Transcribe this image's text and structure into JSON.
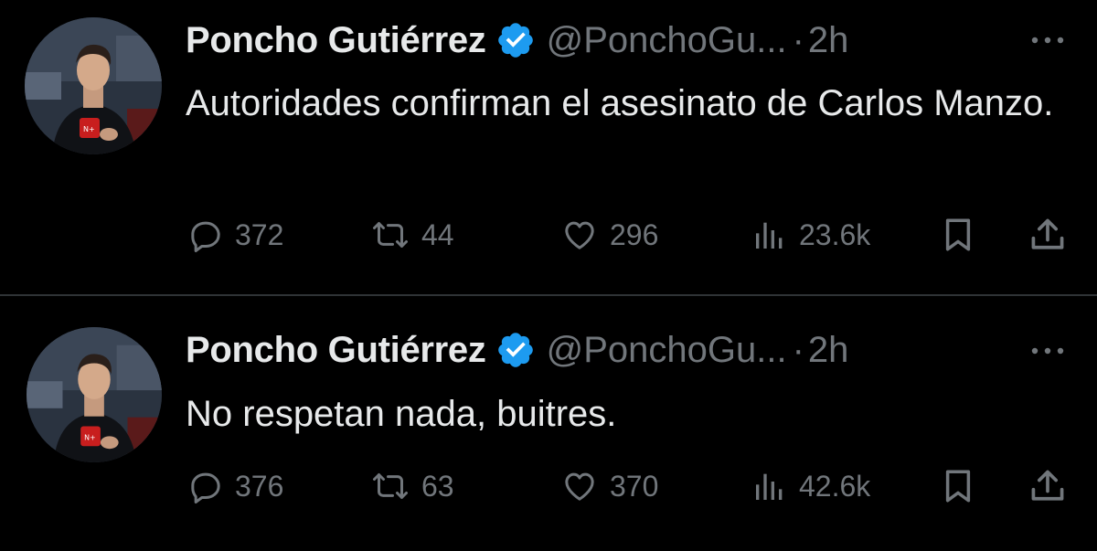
{
  "tweets": [
    {
      "author": {
        "name": "Poncho Gutiérrez",
        "handle": "@PonchoGu...",
        "verified": true
      },
      "time": "2h",
      "separator": "·",
      "text": "Autoridades confirman el asesinato de Carlos Manzo.",
      "stats": {
        "replies": "372",
        "retweets": "44",
        "likes": "296",
        "views": "23.6k"
      }
    },
    {
      "author": {
        "name": "Poncho Gutiérrez",
        "handle": "@PonchoGu...",
        "verified": true
      },
      "time": "2h",
      "separator": "·",
      "text": "No respetan nada, buitres.",
      "stats": {
        "replies": "376",
        "retweets": "63",
        "likes": "370",
        "views": "42.6k"
      }
    }
  ],
  "colors": {
    "background": "#000000",
    "text": "#e7e9ea",
    "muted": "#71767b",
    "verified": "#1d9bf0",
    "divider": "#2f3336"
  },
  "icons": [
    "avatar-photo",
    "verified-badge-icon",
    "more-options-icon",
    "reply-icon",
    "retweet-icon",
    "like-icon",
    "views-icon",
    "bookmark-icon",
    "share-icon"
  ]
}
